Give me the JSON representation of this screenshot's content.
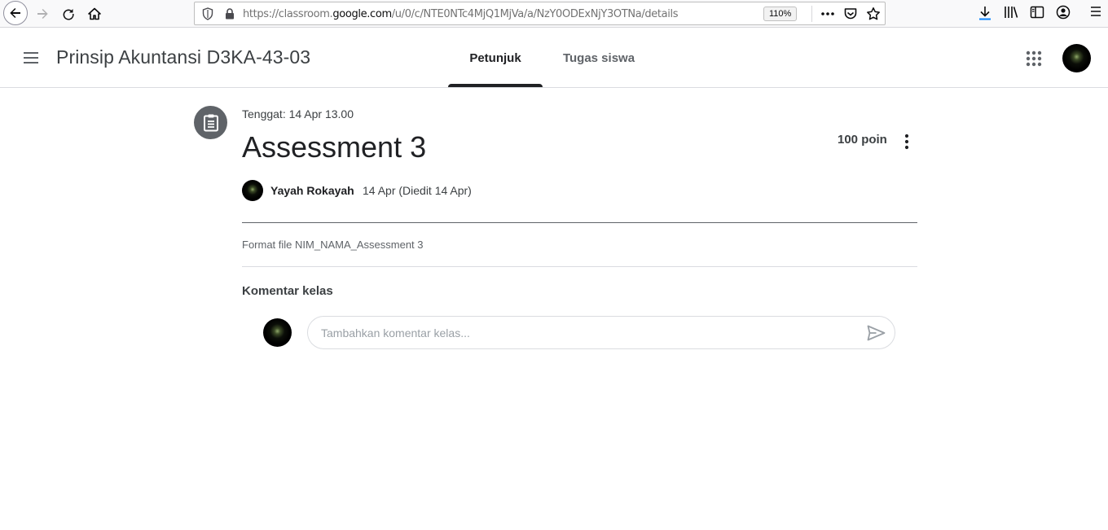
{
  "browser": {
    "url_prefix": "https://classroom.",
    "url_domain": "google.com",
    "url_path": "/u/0/c/NTE0NTc4MjQ1MjVa/a/NzY0ODExNjY3OTNa/details",
    "zoom": "110%"
  },
  "header": {
    "class_name": "Prinsip Akuntansi D3KA-43-03",
    "tabs": [
      {
        "label": "Petunjuk",
        "active": true
      },
      {
        "label": "Tugas siswa",
        "active": false
      }
    ]
  },
  "assignment": {
    "due": "Tenggat: 14 Apr 13.00",
    "title": "Assessment 3",
    "points": "100 poin",
    "author": "Yayah Rokayah",
    "date": "14 Apr (Diedit 14 Apr)",
    "description": "Format file NIM_NAMA_Assessment 3"
  },
  "comments": {
    "heading": "Komentar kelas",
    "placeholder": "Tambahkan komentar kelas..."
  },
  "icons": {
    "type": "assignment-icon",
    "send": "send-icon",
    "more": "more-vert-icon",
    "apps": "apps-grid-icon",
    "menu": "hamburger-menu-icon"
  },
  "colors": {
    "text_primary": "#202124",
    "text_secondary": "#5f6368",
    "icon_circle": "#5f6368",
    "divider": "#dadce0"
  }
}
